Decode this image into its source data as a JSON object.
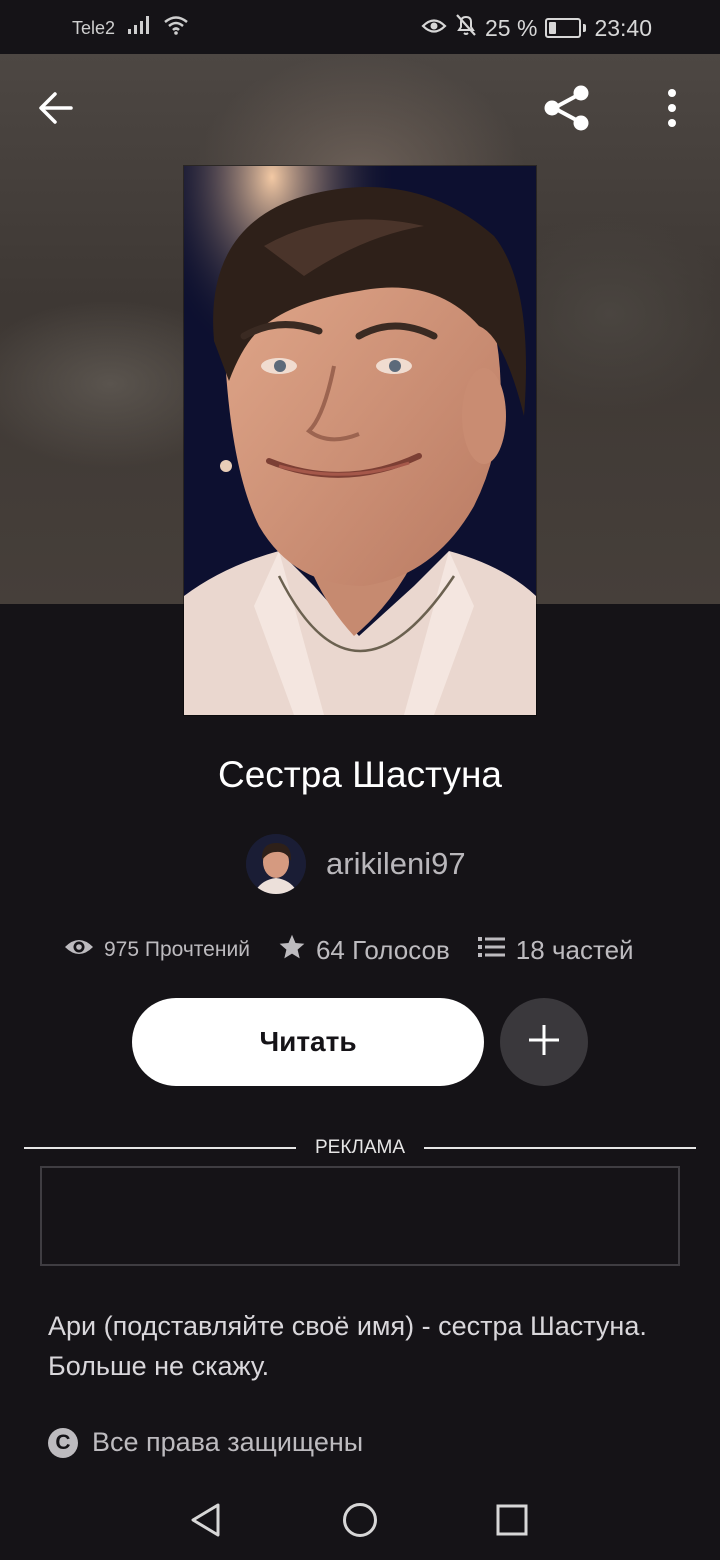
{
  "status_bar": {
    "carrier": "Tele2",
    "battery_text": "25 %",
    "battery_level": 0.25,
    "time": "23:40",
    "icons": [
      "signal-icon",
      "wifi-icon",
      "eye-icon",
      "bell-off-icon",
      "battery-icon"
    ]
  },
  "header": {
    "icons": [
      "back-arrow-icon",
      "share-icon",
      "more-vertical-icon"
    ]
  },
  "story": {
    "title": "Сестра Шастуна",
    "author": "arikileni97",
    "stats": {
      "reads": "975 Прочтений",
      "votes": "64 Голосов",
      "parts": "18 частей"
    },
    "description": "Ари (подставляйте своё имя) - сестра Шастуна. Больше не скажу.",
    "copyright": "Все права защищены"
  },
  "actions": {
    "read_label": "Читать",
    "add_icon": "plus-icon"
  },
  "ad": {
    "label": "РЕКЛАМА"
  },
  "nav_bar": {
    "icons": [
      "nav-back-icon",
      "nav-home-icon",
      "nav-recent-icon"
    ]
  },
  "colors": {
    "background": "#151317",
    "read_button": "#ffffff",
    "add_button": "#3a383c",
    "muted_text": "#bdbbbf"
  }
}
